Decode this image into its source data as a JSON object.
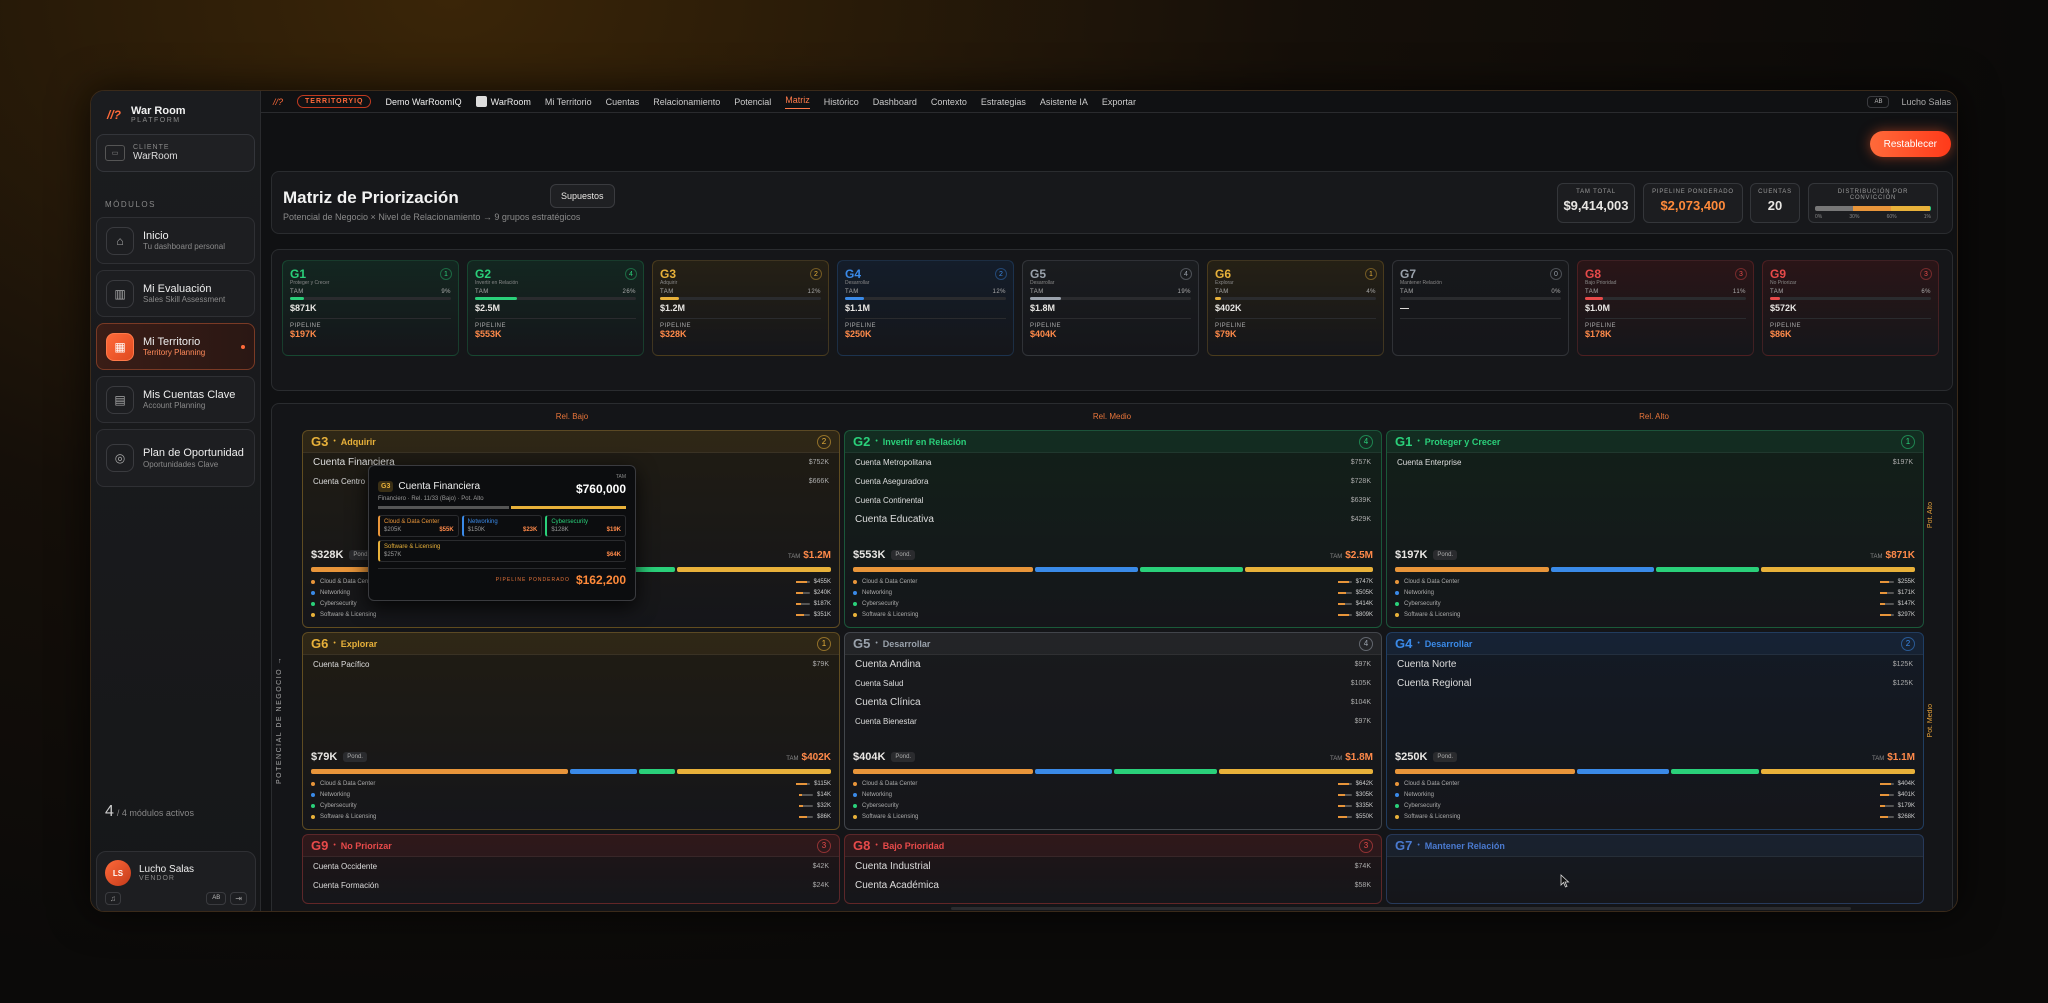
{
  "app": {
    "name": "War Room",
    "sub": "PLATFORM"
  },
  "client": {
    "label": "CLIENTE",
    "name": "WarRoom"
  },
  "modules_label": "MÓDULOS",
  "nav": [
    {
      "t": "Inicio",
      "s": "Tu dashboard personal"
    },
    {
      "t": "Mi Evaluación",
      "s": "Sales Skill Assessment"
    },
    {
      "t": "Mi Territorio",
      "s": "Territory Planning"
    },
    {
      "t": "Mis Cuentas Clave",
      "s": "Account Planning"
    },
    {
      "t": "Plan de Oportunidad",
      "s": "Oportunidades Clave"
    }
  ],
  "mods": {
    "n": "4",
    "t": "/ 4 módulos activos"
  },
  "user": {
    "initials": "LS",
    "name": "Lucho Salas",
    "role": "VENDOR",
    "ab": "AB"
  },
  "top": {
    "badge": "TERRITORYIQ",
    "org": "Demo WarRoomIQ",
    "ws": "WarRoom",
    "tabs": [
      "Mi Territorio",
      "Cuentas",
      "Relacionamiento",
      "Potencial",
      "Matriz",
      "Histórico",
      "Dashboard",
      "Contexto",
      "Estrategias",
      "Asistente IA",
      "Exportar"
    ],
    "ab": "AB",
    "user": "Lucho Salas"
  },
  "reset": "Restablecer",
  "header": {
    "title": "Matriz de Priorización",
    "sub": "Potencial de Negocio × Nivel de Relacionamiento → 9 grupos estratégicos",
    "sup": "Supuestos",
    "k1l": "TAM TOTAL",
    "k1v": "$9,414,003",
    "k2l": "PIPELINE PONDERADO",
    "k2v": "$2,073,400",
    "k3l": "CUENTAS",
    "k3v": "20",
    "k4l": "DISTRIBUCIÓN POR CONVICCIÓN",
    "k4a": "0%",
    "k4b": "30%",
    "k4c": "60%",
    "k4d": "1%"
  },
  "groups": [
    {
      "id": "G1",
      "sub": "Proteger y Crecer",
      "n": "1",
      "tam": "$871K",
      "pct": "9%",
      "pip": "$197K",
      "fill": 0.09,
      "c": "#2ad07a",
      "bg": "#132620"
    },
    {
      "id": "G2",
      "sub": "Invertir en Relación",
      "n": "4",
      "tam": "$2.5M",
      "pct": "26%",
      "pip": "$553K",
      "fill": 0.26,
      "c": "#2ad07a",
      "bg": "#132620"
    },
    {
      "id": "G3",
      "sub": "Adquirir",
      "n": "2",
      "tam": "$1.2M",
      "pct": "12%",
      "pip": "$328K",
      "fill": 0.12,
      "c": "#e8b13a",
      "bg": "#252015"
    },
    {
      "id": "G4",
      "sub": "Desarrollar",
      "n": "2",
      "tam": "$1.1M",
      "pct": "12%",
      "pip": "$250K",
      "fill": 0.12,
      "c": "#3a8ae8",
      "bg": "#141d2a"
    },
    {
      "id": "G5",
      "sub": "Desarrollar",
      "n": "4",
      "tam": "$1.8M",
      "pct": "19%",
      "pip": "$404K",
      "fill": 0.19,
      "c": "#9aa2ac",
      "bg": "#1a1c1f"
    },
    {
      "id": "G6",
      "sub": "Explorar",
      "n": "1",
      "tam": "$402K",
      "pct": "4%",
      "pip": "$79K",
      "fill": 0.04,
      "c": "#e8b13a",
      "bg": "#252015"
    },
    {
      "id": "G7",
      "sub": "Mantener Relación",
      "n": "0",
      "tam": "—",
      "pct": "0%",
      "pip": "",
      "fill": 0,
      "c": "#9aa2ac",
      "bg": "#17181b"
    },
    {
      "id": "G8",
      "sub": "Bajo Prioridad",
      "n": "3",
      "tam": "$1.0M",
      "pct": "11%",
      "pip": "$178K",
      "fill": 0.11,
      "c": "#e84a4a",
      "bg": "#2a1517"
    },
    {
      "id": "G9",
      "sub": "No Priorizar",
      "n": "3",
      "tam": "$572K",
      "pct": "6%",
      "pip": "$86K",
      "fill": 0.06,
      "c": "#e84a4a",
      "bg": "#2a1517"
    }
  ],
  "labels": {
    "tam": "TAM",
    "pipeline": "PIPELINE",
    "pond": "Pond.",
    "tamsm": "TAM"
  },
  "cols": [
    "Rel. Bajo",
    "Rel. Medio",
    "Rel. Alto"
  ],
  "axis": "POTENCIAL DE NEGOCIO →",
  "rows": [
    "Pot. Alto",
    "Pot. Medio"
  ],
  "legend": [
    "Cloud & Data Center",
    "Networking",
    "Cybersecurity",
    "Software & Licensing"
  ],
  "cells": [
    {
      "id": "G3",
      "name": "Adquirir",
      "n": "2",
      "c": "#e8b13a",
      "bg": "#201c13",
      "accts": [
        {
          "n": "Cuenta Financiera",
          "v": "$752K",
          "big": true
        },
        {
          "n": "Cuenta Centro",
          "v": "$666K"
        }
      ],
      "tot": "$328K",
      "tam": "$1.2M",
      "seg": [
        0.5,
        0.1,
        0.1,
        0.3
      ],
      "lv": [
        "$455K",
        "$240K",
        "$187K",
        "$351K"
      ],
      "lf": [
        0.8,
        0.5,
        0.4,
        0.6
      ]
    },
    {
      "id": "G2",
      "name": "Invertir en Relación",
      "n": "4",
      "c": "#2ad07a",
      "bg": "#122019",
      "accts": [
        {
          "n": "Cuenta Metropolitana",
          "v": "$757K"
        },
        {
          "n": "Cuenta Aseguradora",
          "v": "$728K"
        },
        {
          "n": "Cuenta Continental",
          "v": "$639K"
        },
        {
          "n": "Cuenta Educativa",
          "v": "$429K",
          "big": true
        }
      ],
      "tot": "$553K",
      "tam": "$2.5M",
      "seg": [
        0.35,
        0.2,
        0.2,
        0.25
      ],
      "lv": [
        "$747K",
        "$505K",
        "$414K",
        "$809K"
      ],
      "lf": [
        0.8,
        0.6,
        0.5,
        0.8
      ]
    },
    {
      "id": "G1",
      "name": "Proteger y Crecer",
      "n": "1",
      "c": "#2ad07a",
      "bg": "#122019",
      "accts": [
        {
          "n": "Cuenta Enterprise",
          "v": "$197K"
        }
      ],
      "tot": "$197K",
      "tam": "$871K",
      "seg": [
        0.3,
        0.2,
        0.2,
        0.3
      ],
      "lv": [
        "$255K",
        "$171K",
        "$147K",
        "$297K"
      ],
      "lf": [
        0.7,
        0.5,
        0.4,
        0.8
      ]
    },
    {
      "id": "G6",
      "name": "Explorar",
      "n": "1",
      "c": "#e8b13a",
      "bg": "#201c13",
      "accts": [
        {
          "n": "Cuenta Pacífico",
          "v": "$79K"
        }
      ],
      "tot": "$79K",
      "tam": "$402K",
      "seg": [
        0.5,
        0.13,
        0.07,
        0.3
      ],
      "lv": [
        "$115K",
        "$14K",
        "$32K",
        "$86K"
      ],
      "lf": [
        0.8,
        0.2,
        0.3,
        0.6
      ]
    },
    {
      "id": "G5",
      "name": "Desarrollar",
      "n": "4",
      "c": "#9aa2ac",
      "bg": "#191a1d",
      "accts": [
        {
          "n": "Cuenta Andina",
          "v": "$97K",
          "big": true
        },
        {
          "n": "Cuenta Salud",
          "v": "$105K"
        },
        {
          "n": "Cuenta Clínica",
          "v": "$104K",
          "big": true
        },
        {
          "n": "Cuenta Bienestar",
          "v": "$97K"
        }
      ],
      "tot": "$404K",
      "tam": "$1.8M",
      "seg": [
        0.35,
        0.15,
        0.2,
        0.3
      ],
      "lv": [
        "$642K",
        "$305K",
        "$335K",
        "$550K"
      ],
      "lf": [
        0.8,
        0.5,
        0.5,
        0.7
      ]
    },
    {
      "id": "G4",
      "name": "Desarrollar",
      "n": "2",
      "c": "#3a8ae8",
      "bg": "#131a25",
      "accts": [
        {
          "n": "Cuenta Norte",
          "v": "$125K",
          "big": true
        },
        {
          "n": "Cuenta Regional",
          "v": "$125K",
          "big": true
        }
      ],
      "tot": "$250K",
      "tam": "$1.1M",
      "seg": [
        0.35,
        0.18,
        0.17,
        0.3
      ],
      "lv": [
        "$404K",
        "$401K",
        "$179K",
        "$268K"
      ],
      "lf": [
        0.8,
        0.7,
        0.4,
        0.6
      ]
    },
    {
      "id": "G9",
      "name": "No Priorizar",
      "n": "3",
      "c": "#e84a4a",
      "bg": "#201416",
      "accts": [
        {
          "n": "Cuenta Occidente",
          "v": "$42K"
        },
        {
          "n": "Cuenta Formación",
          "v": "$24K"
        }
      ]
    },
    {
      "id": "G8",
      "name": "Bajo Prioridad",
      "n": "3",
      "c": "#e84a4a",
      "bg": "#201416",
      "accts": [
        {
          "n": "Cuenta Industrial",
          "v": "$74K",
          "big": true
        },
        {
          "n": "Cuenta Académica",
          "v": "$58K",
          "big": true
        }
      ]
    },
    {
      "id": "G7",
      "name": "Mantener Relación",
      "n": "",
      "c": "#4a7ad0",
      "bg": "#151a22",
      "accts": []
    }
  ],
  "tip": {
    "g": "G3",
    "name": "Cuenta Financiera",
    "tamL": "TAM",
    "tam": "$760,000",
    "meta": "Financiero · Rel. 11/33 (Bajo) · Pot. Alto",
    "seg": [
      {
        "n": "Cloud & Data Center",
        "a": "$205K",
        "b": "$55K",
        "c": "#e8953a"
      },
      {
        "n": "Networking",
        "a": "$150K",
        "b": "$23K",
        "c": "#3a8ae8"
      },
      {
        "n": "Cybersecurity",
        "a": "$128K",
        "b": "$19K",
        "c": "#2ad07a"
      },
      {
        "n": "Software & Licensing",
        "a": "$257K",
        "b": "$64K",
        "c": "#e8b13a"
      }
    ],
    "pipL": "PIPELINE PONDERADO",
    "pip": "$162,200"
  },
  "colors": {
    "cloud": "#e8953a",
    "net": "#3a8ae8",
    "cyber": "#2ad07a",
    "soft": "#e8b13a"
  }
}
